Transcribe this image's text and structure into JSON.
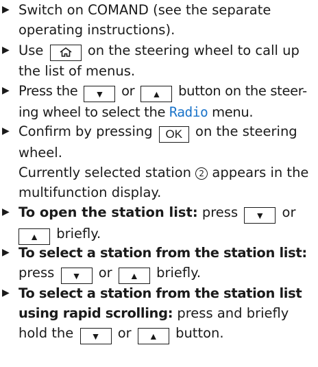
{
  "bullet": "▶",
  "steps": [
    {
      "text": "Switch on COMAND (see the separate operating instructions)."
    },
    {
      "pre": "Use",
      "key_icon": "home-icon",
      "post": "on the steering wheel to call up the list of menus."
    },
    {
      "pre": "Press the",
      "key_down": "▼",
      "mid": "or",
      "key_up": "▲",
      "post1": "button on the steer-",
      "post2": "ing wheel to select the",
      "menu_name": "Radio",
      "post3": "menu."
    },
    {
      "pre": "Confirm by pressing",
      "key_ok": "OK",
      "post": "on the steering wheel.",
      "result_pre": "Currently selected station",
      "result_num": "2",
      "result_post": "appears in the multifunction display."
    },
    {
      "lead": "To open the station list:",
      "pre": "press",
      "key_down": "▼",
      "mid": "or",
      "key_up": "▲",
      "post": "briefly."
    },
    {
      "lead": "To select a station from the station list:",
      "pre": "press",
      "key_down": "▼",
      "mid": "or",
      "key_up": "▲",
      "post": "briefly."
    },
    {
      "lead": "To select a station from the station list using rapid scrolling:",
      "pre": "press and briefly hold the",
      "key_down": "▼",
      "mid": "or",
      "key_up": "▲",
      "post": "button."
    }
  ]
}
